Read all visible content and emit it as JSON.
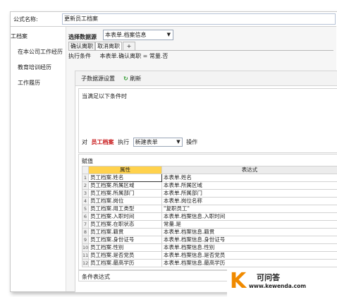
{
  "formula": {
    "label": "公式名称:",
    "value": "更新员工档案"
  },
  "left_nav": {
    "header": "工档案",
    "items": [
      "在本公司工作经历",
      "教育培训经历",
      "工作履历"
    ]
  },
  "data_source": {
    "label": "选择数据源",
    "value": "本表单.档案信息"
  },
  "tabs": [
    "确认离职",
    "取消离职",
    "+"
  ],
  "condition": {
    "label": "执行条件",
    "value": "本表单.确认离职 = 常量.否"
  },
  "subsource": {
    "settings_label": "子数据源设置",
    "refresh_icon": "refresh-icon",
    "refresh_label": "刷新"
  },
  "cond_box": {
    "title": "当满足以下条件时",
    "action_prefix": "对",
    "action_target": "员工档案",
    "action_exec": "执行",
    "action_select": "新建表单",
    "action_suffix": "操作"
  },
  "assign": {
    "title": "赋值",
    "col_property": "属性",
    "col_expression": "表达式",
    "rows": [
      {
        "idx": "1",
        "prop": "员工档案.姓名",
        "expr": "本表单.姓名"
      },
      {
        "idx": "2",
        "prop": "员工档案.所属区域",
        "expr": "本表单.所属区域"
      },
      {
        "idx": "3",
        "prop": "员工档案.所属部门",
        "expr": "本表单.所属部门"
      },
      {
        "idx": "4",
        "prop": "员工档案.岗位",
        "expr": "本表单.岗位名称"
      },
      {
        "idx": "5",
        "prop": "员工档案.用工类型",
        "expr": "\"复职员工\""
      },
      {
        "idx": "6",
        "prop": "员工档案.入职时间",
        "expr": "本表单.档案信息.入职时间"
      },
      {
        "idx": "7",
        "prop": "员工档案.在职状态",
        "expr": "常量.是"
      },
      {
        "idx": "8",
        "prop": "员工档案.籍贯",
        "expr": "本表单.档案信息.籍贯"
      },
      {
        "idx": "9",
        "prop": "员工档案.身份证号",
        "expr": "本表单.档案信息.身份证号"
      },
      {
        "idx": "10",
        "prop": "员工档案.性别",
        "expr": "本表单.档案信息.性别"
      },
      {
        "idx": "11",
        "prop": "员工档案.是否党员",
        "expr": "本表单.档案信息.是否党员"
      },
      {
        "idx": "12",
        "prop": "员工档案.最高学历",
        "expr": "本表单.档案信息.最高学历"
      }
    ]
  },
  "footer": {
    "label": "条件表达式"
  },
  "watermark": {
    "letter": "K",
    "name": "可问答",
    "url": "www.kewenda.com"
  }
}
